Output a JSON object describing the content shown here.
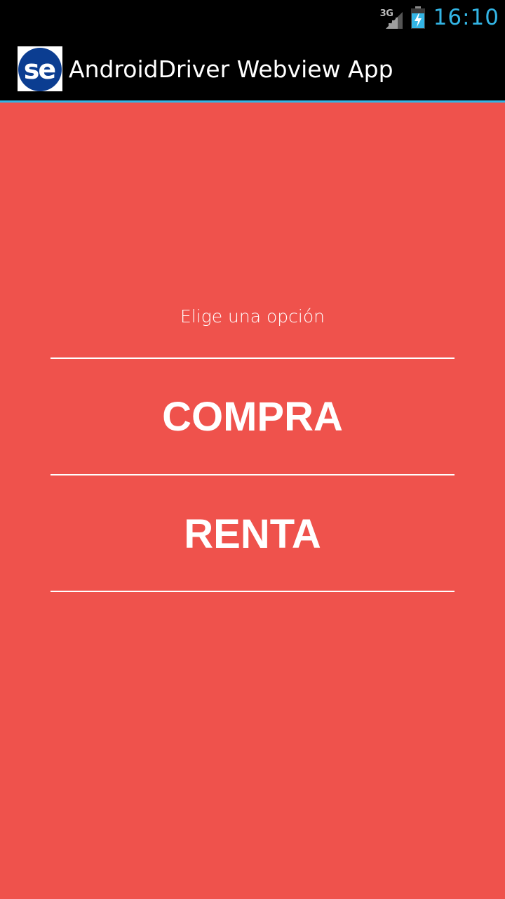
{
  "status_bar": {
    "network_type": "3G",
    "time": "16:10",
    "accent_color": "#33b5e5"
  },
  "action_bar": {
    "app_icon": "selenium-se-logo-icon",
    "title": "AndroidDriver Webview App"
  },
  "webview": {
    "background_color": "#ef524c",
    "prompt": "Elige una opción",
    "options": [
      {
        "label": "COMPRA"
      },
      {
        "label": "RENTA"
      }
    ]
  }
}
